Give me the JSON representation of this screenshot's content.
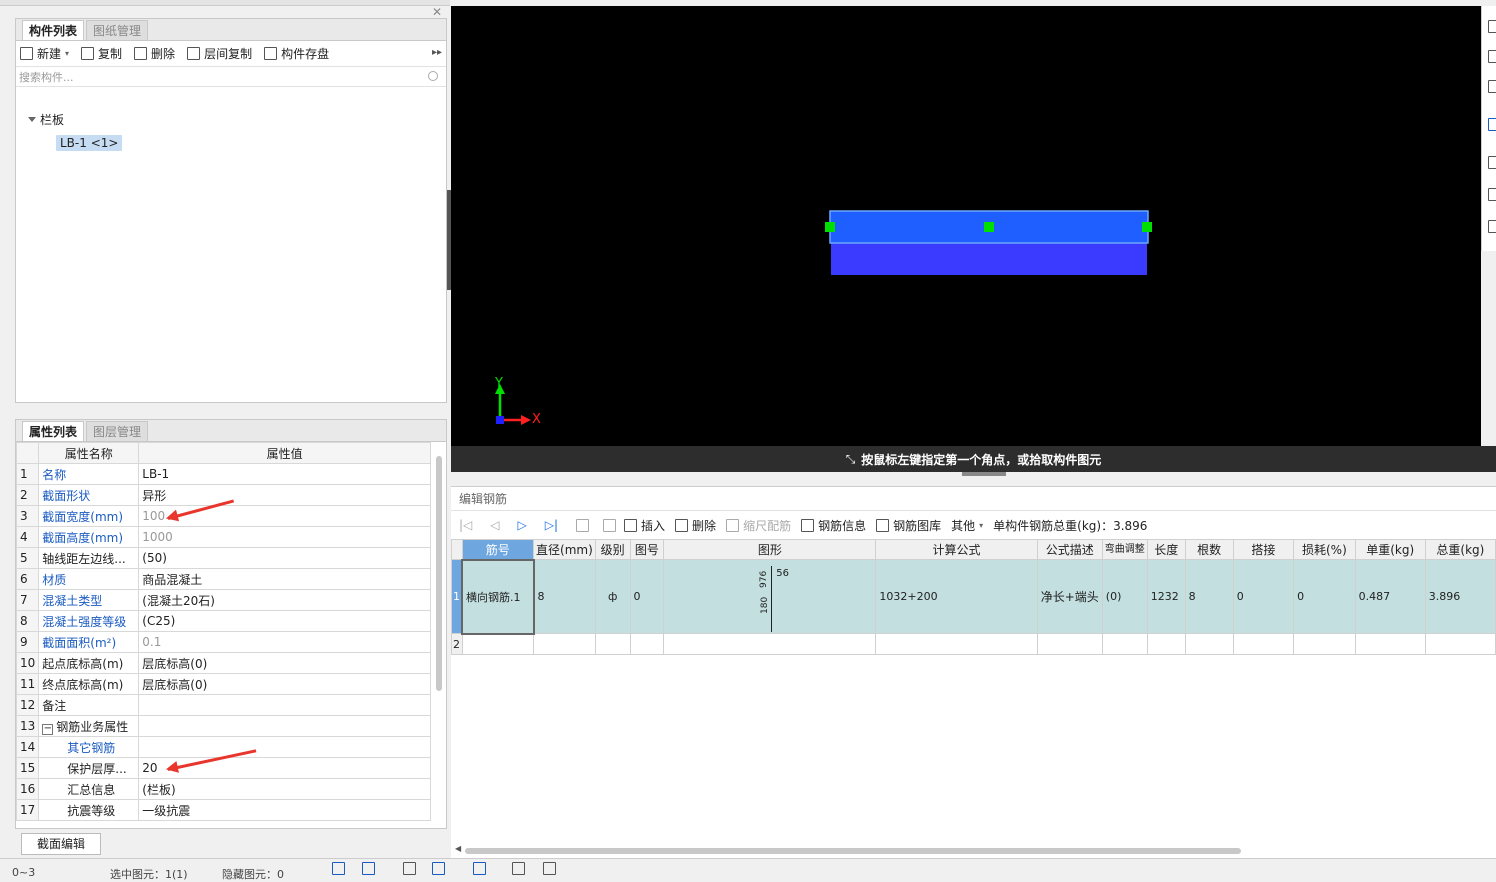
{
  "component_panel": {
    "tabs": [
      "构件列表",
      "图纸管理"
    ],
    "toolbar": [
      "新建",
      "复制",
      "删除",
      "层间复制",
      "构件存盘"
    ],
    "search_placeholder": "搜索构件...",
    "tree_parent": "栏板",
    "tree_child": "LB-1 <1>"
  },
  "property_panel": {
    "tabs": [
      "属性列表",
      "图层管理"
    ],
    "headers": [
      "属性名称",
      "属性值"
    ],
    "rows": [
      {
        "n": "1",
        "name": "名称",
        "value": "LB-1"
      },
      {
        "n": "2",
        "name": "截面形状",
        "value": "异形"
      },
      {
        "n": "3",
        "name": "截面宽度(mm)",
        "value": "100"
      },
      {
        "n": "4",
        "name": "截面高度(mm)",
        "value": "1000"
      },
      {
        "n": "5",
        "name": "轴线距左边线...",
        "value": "(50)"
      },
      {
        "n": "6",
        "name": "材质",
        "value": "商品混凝土"
      },
      {
        "n": "7",
        "name": "混凝土类型",
        "value": "(混凝土20石)"
      },
      {
        "n": "8",
        "name": "混凝土强度等级",
        "value": "(C25)"
      },
      {
        "n": "9",
        "name": "截面面积(m²)",
        "value": "0.1"
      },
      {
        "n": "10",
        "name": "起点底标高(m)",
        "value": "层底标高(0)"
      },
      {
        "n": "11",
        "name": "终点底标高(m)",
        "value": "层底标高(0)"
      },
      {
        "n": "12",
        "name": "备注",
        "value": ""
      },
      {
        "n": "13",
        "name": "钢筋业务属性",
        "value": ""
      },
      {
        "n": "14",
        "name": "其它钢筋",
        "value": ""
      },
      {
        "n": "15",
        "name": "保护层厚...",
        "value": "20"
      },
      {
        "n": "16",
        "name": "汇总信息",
        "value": "(栏板)"
      },
      {
        "n": "17",
        "name": "抗震等级",
        "value": "一级抗震"
      }
    ],
    "section_button": "截面编辑"
  },
  "viewport": {
    "status_text": "按鼠标左键指定第一个角点，或拾取构件图元",
    "axis_x": "X",
    "axis_y": "Y"
  },
  "rebar_editor": {
    "title": "编辑钢筋",
    "toolbar": [
      "插入",
      "删除",
      "缩尺配筋",
      "钢筋信息",
      "钢筋图库",
      "其他"
    ],
    "total_weight": "单构件钢筋总重(kg)：3.896",
    "headers": [
      "筋号",
      "直径(mm)",
      "级别",
      "图号",
      "图形",
      "计算公式",
      "公式描述",
      "弯曲调整",
      "长度",
      "根数",
      "搭接",
      "损耗(%)",
      "单重(kg)",
      "总重(kg)"
    ],
    "row": {
      "n": "1",
      "name": "横向钢筋.1",
      "diameter": "8",
      "grade": "ф",
      "figure_no": "0",
      "shape_top": "56",
      "shape_label": "976",
      "shape_side": "180",
      "formula": "1032+200",
      "desc": "净长+端头",
      "bend": "(0)",
      "length": "1232",
      "count": "8",
      "lap": "0",
      "loss": "0",
      "unit_w": "0.487",
      "total_w": "3.896"
    },
    "row2_n": "2"
  },
  "bottom_bar": {
    "layer": "0~3",
    "selected": "选中图元：1(1)",
    "hidden": "隐藏图元：0"
  },
  "colors": {
    "slab_top": "#1f5fff",
    "slab_bottom": "#3b3bff",
    "grip": "#00e000",
    "selected_row": "#c3dfe0"
  }
}
